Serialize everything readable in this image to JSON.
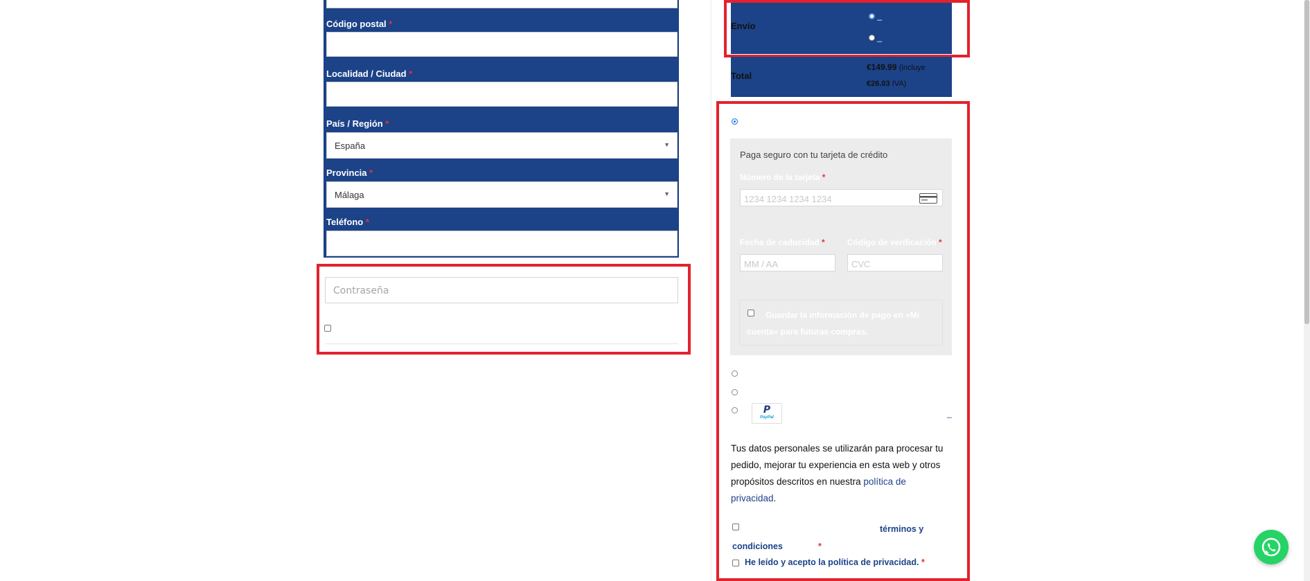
{
  "billing": {
    "postal_code_label": "Código postal",
    "city_label": "Localidad / Ciudad",
    "country_label": "País / Región",
    "country_value": "España",
    "province_label": "Provincia",
    "province_value": "Málaga",
    "phone_label": "Teléfono",
    "required_mark": "*"
  },
  "account": {
    "password_placeholder": "Contraseña"
  },
  "order": {
    "shipping_label": "Envío",
    "shipping_option_1": "_",
    "shipping_option_2": "_",
    "total_label": "Total",
    "total_amount": "€149.99",
    "total_includes": "(incluye",
    "tax_amount": "€26.03",
    "tax_label": "IVA)"
  },
  "payment": {
    "card_description": "Paga seguro con tu tarjeta de crédito",
    "card_number_label": "Número de la tarjeta",
    "card_number_placeholder": "1234 1234 1234 1234",
    "expiry_label": "Fecha de caducidad",
    "expiry_placeholder": "MM / AA",
    "cvc_label": "Código de verificación",
    "cvc_placeholder": "CVC",
    "save_info_label": "Guardar la información de pago en «Mi cuenta» para futuras compras.",
    "paypal_link": "_",
    "paypal_badge": "PayPal"
  },
  "privacy": {
    "text": "Tus datos personales se utilizarán para procesar tu pedido, mejorar tu experiencia en esta web y otros propósitos descritos en nuestra",
    "link": "política de privacidad",
    "period": ".",
    "terms_link": "términos y condiciones",
    "privacy_accept": "He leído y acepto la política de privacidad."
  },
  "colors": {
    "brand_blue": "#1c4288",
    "highlight_red": "#e2222d",
    "whatsapp_green": "#25d366"
  },
  "icons": [
    "credit-card-icon",
    "paypal-icon",
    "whatsapp-icon"
  ]
}
